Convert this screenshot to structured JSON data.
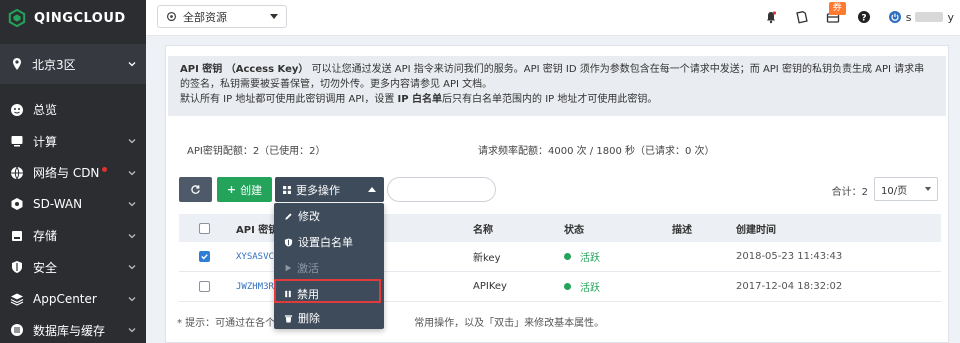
{
  "brand": {
    "logo_text": "QINGCLOUD",
    "accent": "#23a45a"
  },
  "sidebar": {
    "region": "北京3区",
    "items": [
      {
        "label": "总览",
        "icon": "dashboard-icon"
      },
      {
        "label": "计算",
        "icon": "monitor-icon"
      },
      {
        "label": "网络与 CDN",
        "icon": "globe-icon",
        "badge": true
      },
      {
        "label": "SD-WAN",
        "icon": "hexagon-icon"
      },
      {
        "label": "存储",
        "icon": "storage-icon"
      },
      {
        "label": "安全",
        "icon": "shield-icon"
      },
      {
        "label": "AppCenter",
        "icon": "layers-icon"
      },
      {
        "label": "数据库与缓存",
        "icon": "database-icon"
      }
    ]
  },
  "topbar": {
    "resource_select": "全部资源",
    "coupon_badge": "券",
    "user_initial": "s",
    "user_suffix": "y"
  },
  "notice": {
    "line1_bold": "API 密钥 （Access Key）",
    "line1": "可以让您通过发送 API 指令来访问我们的服务。API 密钥 ID 须作为参数包含在每一个请求中发送；而 API 密钥的私钥负责生成 API 请求串的签名，私钥需要被妥善保管，切勿外传。更多内容请参见 API 文档。",
    "line2_a": "默认所有 IP 地址都可使用此密钥调用 API，设置 ",
    "line2_bold": "IP 白名单",
    "line2_b": "后只有白名单范围内的 IP 地址才可使用此密钥。"
  },
  "quota": {
    "keys": "API密钥配额：2（已使用：2）",
    "rate": "请求频率配额：4000 次 / 1800 秒（已请求：0 次）"
  },
  "toolbar": {
    "create_label": "创建",
    "more_label": "更多操作",
    "total_label": "合计：2",
    "page_size": "10/页"
  },
  "table": {
    "columns": [
      "API 密钥",
      "名称",
      "状态",
      "描述",
      "创建时间"
    ],
    "rows": [
      {
        "checked": true,
        "id": "XYSASVCH",
        "name": "新key",
        "status": "活跃",
        "desc": "",
        "created": "2018-05-23 11:43:43"
      },
      {
        "checked": false,
        "id": "JWZHM3R",
        "name": "APIKey",
        "status": "活跃",
        "desc": "",
        "created": "2017-12-04 18:32:02"
      }
    ]
  },
  "footer_hint": "* 提示：可通过在各个页面中用鼠标右键点击列表项来进行常用操作，以及「双击」来修改基本属性。",
  "hint_visible_a": "* 提示：可通过在各个页",
  "hint_visible_b": "常用操作，以及「双击」来修改基本属性。",
  "menu": {
    "items": [
      {
        "label": "修改",
        "icon": "pencil-icon",
        "disabled": false
      },
      {
        "label": "设置白名单",
        "icon": "shield-icon",
        "disabled": false
      },
      {
        "label": "激活",
        "icon": "play-icon",
        "disabled": true
      },
      {
        "label": "禁用",
        "icon": "pause-icon",
        "disabled": false
      },
      {
        "label": "删除",
        "icon": "trash-icon",
        "disabled": false
      }
    ],
    "highlighted": "禁用"
  }
}
